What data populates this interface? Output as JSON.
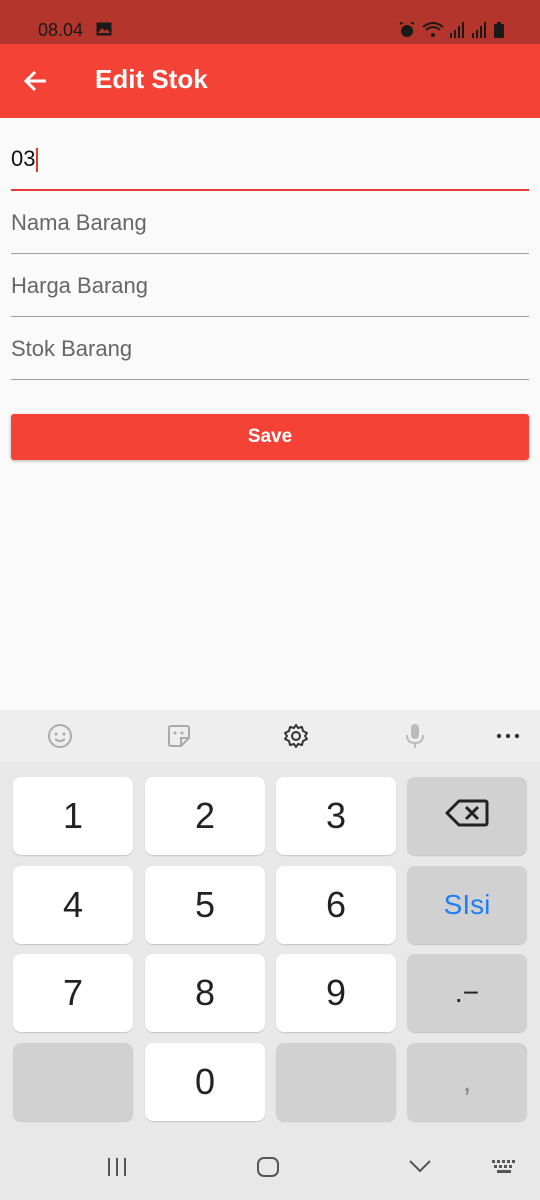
{
  "status": {
    "time": "08.04"
  },
  "appbar": {
    "title": "Edit Stok"
  },
  "form": {
    "code_value": "03",
    "name_placeholder": "Nama Barang",
    "price_placeholder": "Harga Barang",
    "stock_placeholder": "Stok Barang",
    "save_label": "Save"
  },
  "keyboard": {
    "keys": {
      "k1": "1",
      "k2": "2",
      "k3": "3",
      "k4": "4",
      "k5": "5",
      "k6": "6",
      "k7": "7",
      "k8": "8",
      "k9": "9",
      "k0": "0",
      "fill": "SIsi",
      "symbols": ".−",
      "comma": ","
    }
  }
}
